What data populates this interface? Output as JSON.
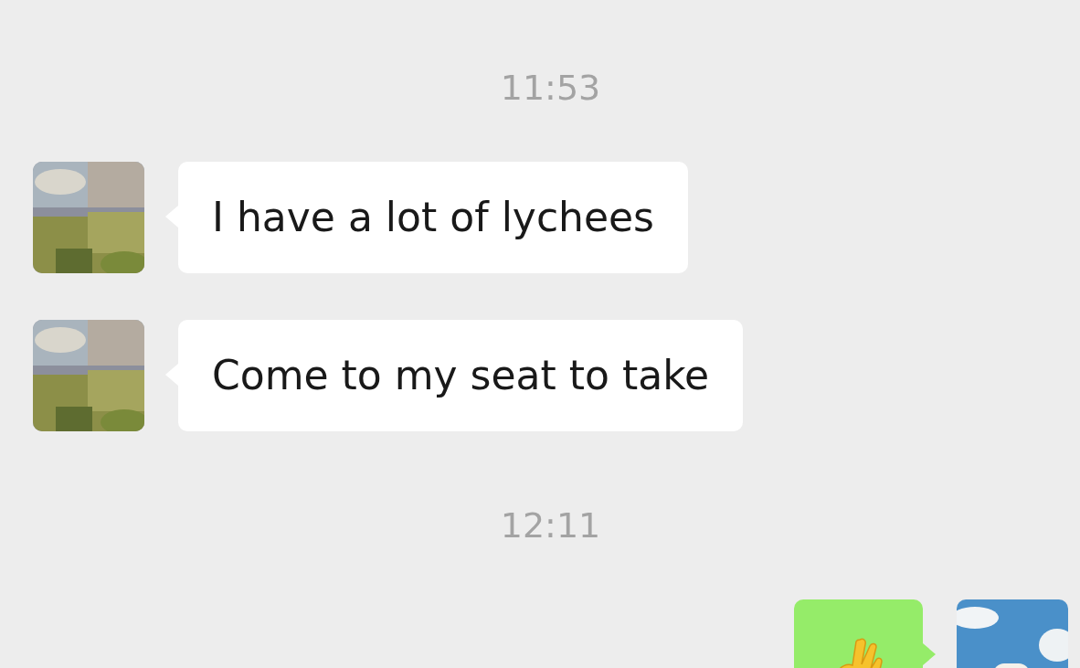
{
  "chat": [
    {
      "kind": "time",
      "text": "11:53"
    },
    {
      "kind": "text",
      "outgoing": false,
      "text": "I have a lot of lychees"
    },
    {
      "kind": "text",
      "outgoing": false,
      "text": "Come to my seat to take"
    },
    {
      "kind": "time",
      "text": "12:11"
    },
    {
      "kind": "ok-hand",
      "outgoing": true
    }
  ]
}
